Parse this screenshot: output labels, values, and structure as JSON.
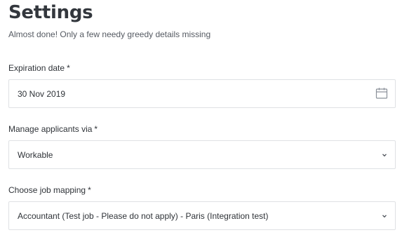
{
  "header": {
    "title": "Settings",
    "subtitle": "Almost done! Only a few needy greedy details missing"
  },
  "fields": {
    "expiration": {
      "label": "Expiration date",
      "required_mark": "*",
      "value": "30 Nov 2019",
      "icon": "calendar-icon"
    },
    "applicants": {
      "label": "Manage applicants via",
      "required_mark": "*",
      "value": "Workable",
      "icon": "chevron-down-icon"
    },
    "job_mapping": {
      "label": "Choose job mapping",
      "required_mark": "*",
      "value": "Accountant (Test job - Please do not apply) - Paris (Integration test)",
      "icon": "chevron-down-icon"
    }
  },
  "colors": {
    "text": "#2f3338",
    "border": "#dfe1e4",
    "icon": "#8a9099"
  }
}
